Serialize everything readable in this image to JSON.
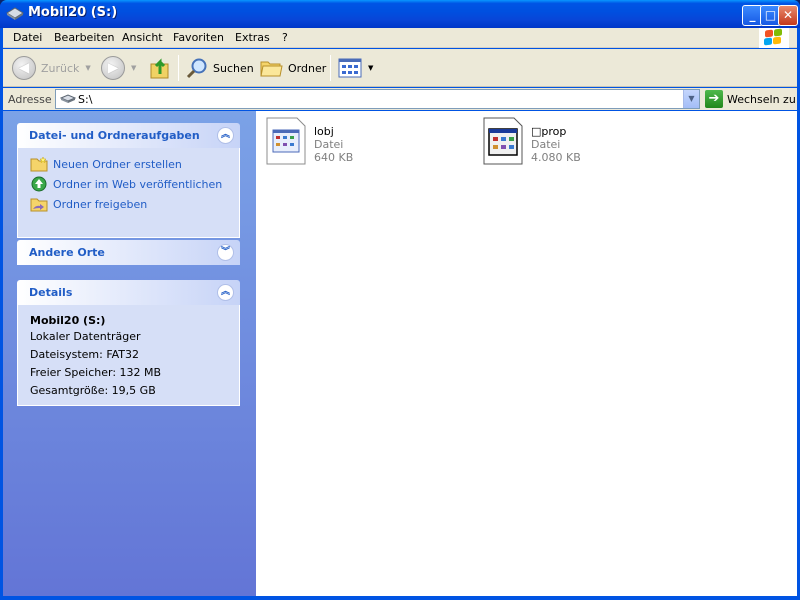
{
  "window": {
    "title": "Mobil20 (S:)"
  },
  "menu": [
    "Datei",
    "Bearbeiten",
    "Ansicht",
    "Favoriten",
    "Extras",
    "?"
  ],
  "toolbar": {
    "back_label": "Zurück",
    "search_label": "Suchen",
    "folders_label": "Ordner"
  },
  "address": {
    "label": "Adresse",
    "value": "S:\\",
    "go_label": "Wechseln zu"
  },
  "panels": {
    "tasks": {
      "title": "Datei- und Ordneraufgaben",
      "items": [
        "Neuen Ordner erstellen",
        "Ordner im Web veröffentlichen",
        "Ordner freigeben"
      ]
    },
    "other_places": {
      "title": "Andere Orte"
    },
    "details": {
      "title": "Details",
      "name": "Mobil20 (S:)",
      "type": "Lokaler Datenträger",
      "filesystem": "Dateisystem: FAT32",
      "free": "Freier Speicher: 132 MB",
      "total": "Gesamtgröße: 19,5 GB"
    }
  },
  "files": [
    {
      "name": "lobj",
      "type": "Datei",
      "size": "640 KB"
    },
    {
      "name": "□prop",
      "type": "Datei",
      "size": "4.080 KB"
    }
  ]
}
